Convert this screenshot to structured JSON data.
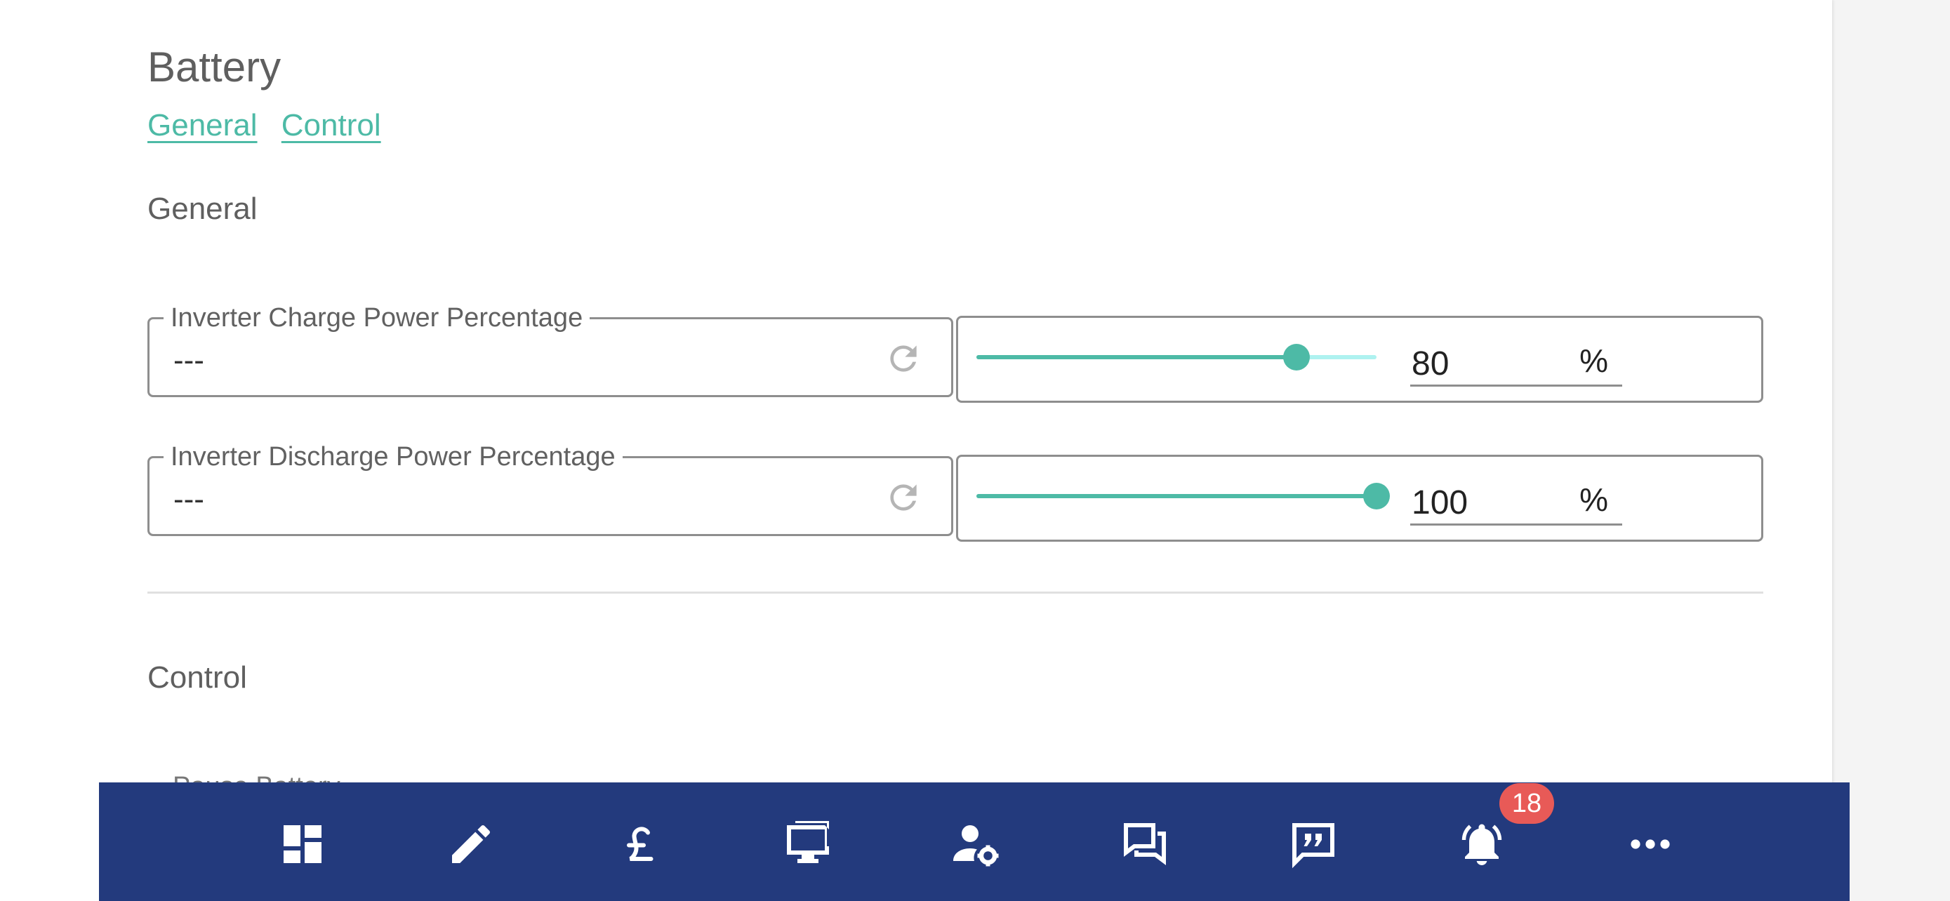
{
  "page": {
    "title": "Battery"
  },
  "links": [
    {
      "label": "General"
    },
    {
      "label": "Control"
    }
  ],
  "sections": {
    "general": {
      "heading": "General"
    },
    "control": {
      "heading": "Control",
      "next_field_label_partial": "Pause Battery"
    }
  },
  "fields": [
    {
      "label": "Inverter Charge Power Percentage",
      "value": "---",
      "slider_value": 80,
      "slider_min": 0,
      "slider_max": 100,
      "unit": "%"
    },
    {
      "label": "Inverter Discharge Power Percentage",
      "value": "---",
      "slider_value": 100,
      "slider_min": 0,
      "slider_max": 100,
      "unit": "%"
    }
  ],
  "bottom_nav": {
    "items": [
      {
        "icon": "dashboard-icon"
      },
      {
        "icon": "pencil-icon"
      },
      {
        "icon": "pound-sign-icon"
      },
      {
        "icon": "monitor-icon"
      },
      {
        "icon": "user-settings-icon"
      },
      {
        "icon": "chat-icon"
      },
      {
        "icon": "feedback-icon"
      },
      {
        "icon": "bell-icon"
      },
      {
        "icon": "more-icon"
      }
    ],
    "notification_count": "18"
  },
  "colors": {
    "accent": "#4dbaa6",
    "nav_bg": "#233a7d",
    "badge": "#e85a57",
    "slider_track": "#aef2f0"
  }
}
